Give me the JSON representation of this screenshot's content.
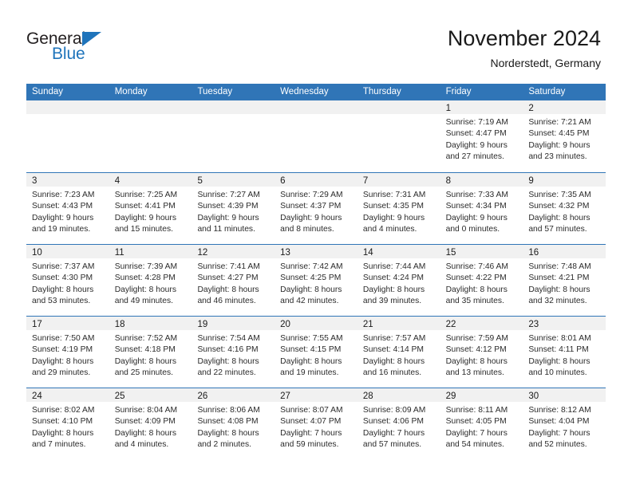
{
  "brand": {
    "name_top": "General",
    "name_bottom": "Blue",
    "triangle_color": "#1f74bb",
    "text_color": "#231f20"
  },
  "header": {
    "title": "November 2024",
    "subtitle": "Norderstedt, Germany"
  },
  "colors": {
    "header_blue": "#3075b7",
    "daynum_band": "#f1f1f1",
    "text": "#1a1a1a"
  },
  "weekdays": [
    "Sunday",
    "Monday",
    "Tuesday",
    "Wednesday",
    "Thursday",
    "Friday",
    "Saturday"
  ],
  "weeks": [
    [
      {
        "day": "",
        "lines": []
      },
      {
        "day": "",
        "lines": []
      },
      {
        "day": "",
        "lines": []
      },
      {
        "day": "",
        "lines": []
      },
      {
        "day": "",
        "lines": []
      },
      {
        "day": "1",
        "lines": [
          "Sunrise: 7:19 AM",
          "Sunset: 4:47 PM",
          "Daylight: 9 hours",
          "and 27 minutes."
        ]
      },
      {
        "day": "2",
        "lines": [
          "Sunrise: 7:21 AM",
          "Sunset: 4:45 PM",
          "Daylight: 9 hours",
          "and 23 minutes."
        ]
      }
    ],
    [
      {
        "day": "3",
        "lines": [
          "Sunrise: 7:23 AM",
          "Sunset: 4:43 PM",
          "Daylight: 9 hours",
          "and 19 minutes."
        ]
      },
      {
        "day": "4",
        "lines": [
          "Sunrise: 7:25 AM",
          "Sunset: 4:41 PM",
          "Daylight: 9 hours",
          "and 15 minutes."
        ]
      },
      {
        "day": "5",
        "lines": [
          "Sunrise: 7:27 AM",
          "Sunset: 4:39 PM",
          "Daylight: 9 hours",
          "and 11 minutes."
        ]
      },
      {
        "day": "6",
        "lines": [
          "Sunrise: 7:29 AM",
          "Sunset: 4:37 PM",
          "Daylight: 9 hours",
          "and 8 minutes."
        ]
      },
      {
        "day": "7",
        "lines": [
          "Sunrise: 7:31 AM",
          "Sunset: 4:35 PM",
          "Daylight: 9 hours",
          "and 4 minutes."
        ]
      },
      {
        "day": "8",
        "lines": [
          "Sunrise: 7:33 AM",
          "Sunset: 4:34 PM",
          "Daylight: 9 hours",
          "and 0 minutes."
        ]
      },
      {
        "day": "9",
        "lines": [
          "Sunrise: 7:35 AM",
          "Sunset: 4:32 PM",
          "Daylight: 8 hours",
          "and 57 minutes."
        ]
      }
    ],
    [
      {
        "day": "10",
        "lines": [
          "Sunrise: 7:37 AM",
          "Sunset: 4:30 PM",
          "Daylight: 8 hours",
          "and 53 minutes."
        ]
      },
      {
        "day": "11",
        "lines": [
          "Sunrise: 7:39 AM",
          "Sunset: 4:28 PM",
          "Daylight: 8 hours",
          "and 49 minutes."
        ]
      },
      {
        "day": "12",
        "lines": [
          "Sunrise: 7:41 AM",
          "Sunset: 4:27 PM",
          "Daylight: 8 hours",
          "and 46 minutes."
        ]
      },
      {
        "day": "13",
        "lines": [
          "Sunrise: 7:42 AM",
          "Sunset: 4:25 PM",
          "Daylight: 8 hours",
          "and 42 minutes."
        ]
      },
      {
        "day": "14",
        "lines": [
          "Sunrise: 7:44 AM",
          "Sunset: 4:24 PM",
          "Daylight: 8 hours",
          "and 39 minutes."
        ]
      },
      {
        "day": "15",
        "lines": [
          "Sunrise: 7:46 AM",
          "Sunset: 4:22 PM",
          "Daylight: 8 hours",
          "and 35 minutes."
        ]
      },
      {
        "day": "16",
        "lines": [
          "Sunrise: 7:48 AM",
          "Sunset: 4:21 PM",
          "Daylight: 8 hours",
          "and 32 minutes."
        ]
      }
    ],
    [
      {
        "day": "17",
        "lines": [
          "Sunrise: 7:50 AM",
          "Sunset: 4:19 PM",
          "Daylight: 8 hours",
          "and 29 minutes."
        ]
      },
      {
        "day": "18",
        "lines": [
          "Sunrise: 7:52 AM",
          "Sunset: 4:18 PM",
          "Daylight: 8 hours",
          "and 25 minutes."
        ]
      },
      {
        "day": "19",
        "lines": [
          "Sunrise: 7:54 AM",
          "Sunset: 4:16 PM",
          "Daylight: 8 hours",
          "and 22 minutes."
        ]
      },
      {
        "day": "20",
        "lines": [
          "Sunrise: 7:55 AM",
          "Sunset: 4:15 PM",
          "Daylight: 8 hours",
          "and 19 minutes."
        ]
      },
      {
        "day": "21",
        "lines": [
          "Sunrise: 7:57 AM",
          "Sunset: 4:14 PM",
          "Daylight: 8 hours",
          "and 16 minutes."
        ]
      },
      {
        "day": "22",
        "lines": [
          "Sunrise: 7:59 AM",
          "Sunset: 4:12 PM",
          "Daylight: 8 hours",
          "and 13 minutes."
        ]
      },
      {
        "day": "23",
        "lines": [
          "Sunrise: 8:01 AM",
          "Sunset: 4:11 PM",
          "Daylight: 8 hours",
          "and 10 minutes."
        ]
      }
    ],
    [
      {
        "day": "24",
        "lines": [
          "Sunrise: 8:02 AM",
          "Sunset: 4:10 PM",
          "Daylight: 8 hours",
          "and 7 minutes."
        ]
      },
      {
        "day": "25",
        "lines": [
          "Sunrise: 8:04 AM",
          "Sunset: 4:09 PM",
          "Daylight: 8 hours",
          "and 4 minutes."
        ]
      },
      {
        "day": "26",
        "lines": [
          "Sunrise: 8:06 AM",
          "Sunset: 4:08 PM",
          "Daylight: 8 hours",
          "and 2 minutes."
        ]
      },
      {
        "day": "27",
        "lines": [
          "Sunrise: 8:07 AM",
          "Sunset: 4:07 PM",
          "Daylight: 7 hours",
          "and 59 minutes."
        ]
      },
      {
        "day": "28",
        "lines": [
          "Sunrise: 8:09 AM",
          "Sunset: 4:06 PM",
          "Daylight: 7 hours",
          "and 57 minutes."
        ]
      },
      {
        "day": "29",
        "lines": [
          "Sunrise: 8:11 AM",
          "Sunset: 4:05 PM",
          "Daylight: 7 hours",
          "and 54 minutes."
        ]
      },
      {
        "day": "30",
        "lines": [
          "Sunrise: 8:12 AM",
          "Sunset: 4:04 PM",
          "Daylight: 7 hours",
          "and 52 minutes."
        ]
      }
    ]
  ]
}
